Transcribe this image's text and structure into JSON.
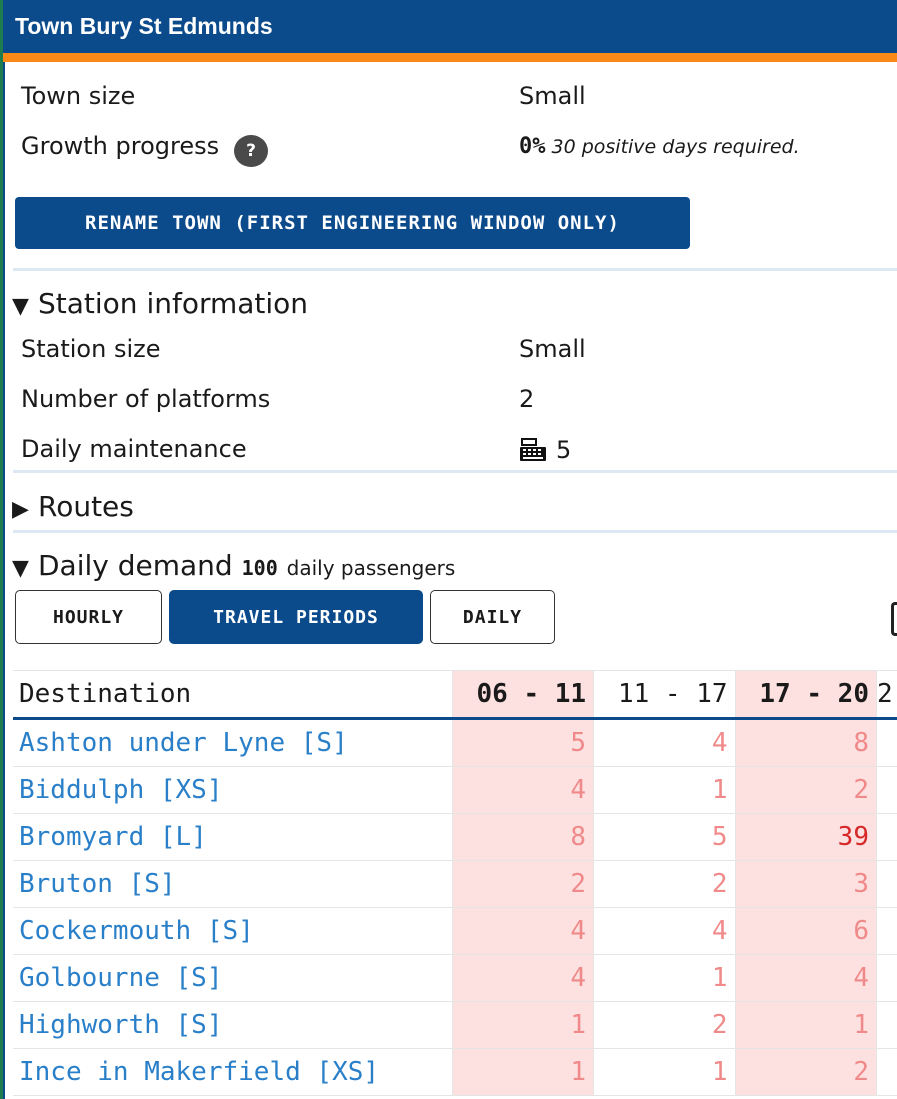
{
  "header": {
    "title": "Town Bury St Edmunds"
  },
  "town": {
    "size_label": "Town size",
    "size_value": "Small",
    "growth_label": "Growth progress",
    "growth_help": "?",
    "growth_pct": "0%",
    "growth_note": "30 positive days required."
  },
  "rename_button": "RENAME TOWN (FIRST ENGINEERING WINDOW ONLY)",
  "station": {
    "heading": "Station information",
    "size_label": "Station size",
    "size_value": "Small",
    "platforms_label": "Number of platforms",
    "platforms_value": "2",
    "maintenance_label": "Daily maintenance",
    "maintenance_value": "5",
    "maintenance_icon": "cash-register-icon"
  },
  "routes": {
    "heading": "Routes"
  },
  "demand": {
    "heading": "Daily demand",
    "total": "100",
    "total_suffix": "daily passengers",
    "tabs": [
      "HOURLY",
      "TRAVEL PERIODS",
      "DAILY"
    ],
    "active_tab": "TRAVEL PERIODS",
    "columns": [
      "Destination",
      "06 - 11",
      "11 - 17",
      "17 - 20",
      "2"
    ],
    "rows": [
      {
        "dest": "Ashton under Lyne [S]",
        "v": [
          "5",
          "4",
          "8"
        ]
      },
      {
        "dest": "Biddulph [XS]",
        "v": [
          "4",
          "1",
          "2"
        ]
      },
      {
        "dest": "Bromyard [L]",
        "v": [
          "8",
          "5",
          "39"
        ]
      },
      {
        "dest": "Bruton [S]",
        "v": [
          "2",
          "2",
          "3"
        ]
      },
      {
        "dest": "Cockermouth [S]",
        "v": [
          "4",
          "4",
          "6"
        ]
      },
      {
        "dest": "Golbourne [S]",
        "v": [
          "4",
          "1",
          "4"
        ]
      },
      {
        "dest": "Highworth [S]",
        "v": [
          "1",
          "2",
          "1"
        ]
      },
      {
        "dest": "Ince in Makerfield [XS]",
        "v": [
          "1",
          "1",
          "2"
        ]
      }
    ]
  },
  "colors": {
    "header_bg": "#0b4a8b",
    "accent": "#f98a17",
    "highlight_col": "#fde0e0",
    "link": "#2a7fc9"
  }
}
